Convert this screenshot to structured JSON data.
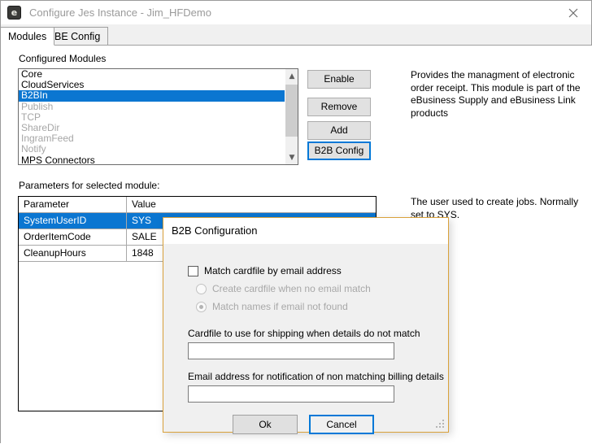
{
  "window": {
    "title": "Configure Jes Instance - Jim_HFDemo",
    "icon": "app-icon",
    "close_icon": "close-icon"
  },
  "tabs": [
    {
      "label": "Modules",
      "active": true
    },
    {
      "label": "BE Config",
      "active": false
    }
  ],
  "modules_section": {
    "label": "Configured Modules",
    "items": [
      {
        "label": "Core",
        "state": "enabled"
      },
      {
        "label": "CloudServices",
        "state": "enabled"
      },
      {
        "label": "B2BIn",
        "state": "selected"
      },
      {
        "label": "Publish",
        "state": "disabled"
      },
      {
        "label": "TCP",
        "state": "disabled"
      },
      {
        "label": "ShareDir",
        "state": "disabled"
      },
      {
        "label": "IngramFeed",
        "state": "disabled"
      },
      {
        "label": "Notify",
        "state": "disabled"
      },
      {
        "label": "MPS Connectors",
        "state": "enabled"
      }
    ],
    "scroll_up_icon": "chevron-up-icon",
    "scroll_down_icon": "chevron-down-icon"
  },
  "buttons": {
    "enable": "Enable",
    "remove": "Remove",
    "add": "Add",
    "b2b_config": "B2B Config"
  },
  "module_description": "Provides the managment of electronic order receipt.  This module is part of the eBusiness Supply and eBusiness Link products",
  "parameter_description": "The user used to create jobs.  Normally set to SYS.",
  "parameters_section": {
    "label": "Parameters for selected module:",
    "columns": [
      "Parameter",
      "Value"
    ],
    "rows": [
      {
        "parameter": "SystemUserID",
        "value": "SYS",
        "selected": true
      },
      {
        "parameter": "OrderItemCode",
        "value": "SALE",
        "selected": false
      },
      {
        "parameter": "CleanupHours",
        "value": "1848",
        "selected": false
      }
    ]
  },
  "dialog": {
    "title": "B2B Configuration",
    "match_cardfile": {
      "label": "Match cardfile by email address",
      "checked": false
    },
    "radios": [
      {
        "label": "Create cardfile when no email match",
        "checked": false,
        "disabled": true
      },
      {
        "label": "Match names if email not found",
        "checked": true,
        "disabled": true
      }
    ],
    "cardfile_field": {
      "label": "Cardfile to use for shipping when details do not match",
      "value": ""
    },
    "email_field": {
      "label": "Email address for notification of non matching billing details",
      "value": ""
    },
    "ok_label": "Ok",
    "cancel_label": "Cancel"
  },
  "colors": {
    "selection_blue": "#0b76d1",
    "focus_blue": "#0078d7",
    "dialog_border": "#d9a13b",
    "disabled_text": "#a6a6a6"
  }
}
